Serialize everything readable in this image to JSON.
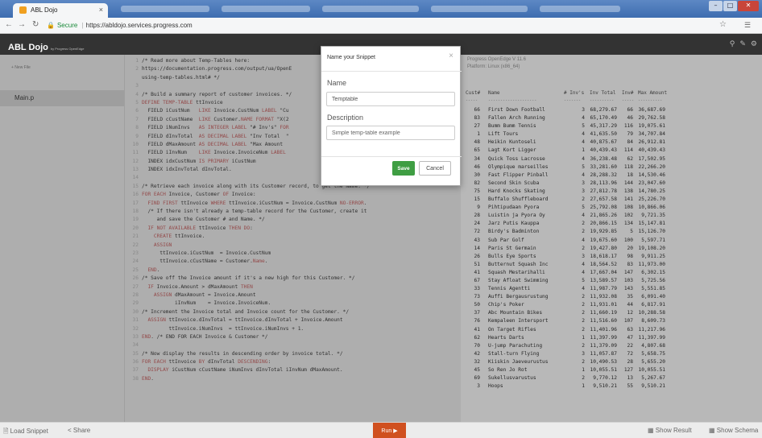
{
  "browser": {
    "tab_title": "ABL Dojo",
    "tab_close": "×",
    "secure_label": "Secure",
    "separator": "|",
    "url": "https://abldojo.services.progress.com"
  },
  "app": {
    "logo_main": "ABL Dojo",
    "logo_by": "by Progress OpenEdge"
  },
  "sidebar": {
    "new_file": "+ New File",
    "files": [
      "Main.p"
    ]
  },
  "editor": {
    "lines": [
      {
        "n": "1",
        "parts": [
          [
            "/* Read more about Temp-Tables here:",
            ""
          ]
        ]
      },
      {
        "n": "2",
        "parts": [
          [
            "https://documentation.progress.com/output/ua/OpenE",
            ""
          ]
        ]
      },
      {
        "n": "",
        "parts": [
          [
            "using-temp-tables.html# */",
            ""
          ]
        ]
      },
      {
        "n": "3",
        "parts": [
          [
            "",
            ""
          ]
        ]
      },
      {
        "n": "4",
        "parts": [
          [
            "/* Build a summary report of customer invoices. */",
            ""
          ]
        ]
      },
      {
        "n": "5",
        "parts": [
          [
            "DEFINE TEMP-TABLE",
            "kw"
          ],
          [
            " ttInvoice",
            ""
          ]
        ]
      },
      {
        "n": "6",
        "parts": [
          [
            "  FIELD iCustNum   ",
            ""
          ],
          [
            "LIKE",
            "kw"
          ],
          [
            " Invoice.CustNum ",
            ""
          ],
          [
            "LABEL",
            "kw"
          ],
          [
            " \"Cu",
            ""
          ]
        ]
      },
      {
        "n": "7",
        "parts": [
          [
            "  FIELD cCustName  ",
            ""
          ],
          [
            "LIKE",
            "kw"
          ],
          [
            " Customer.",
            ""
          ],
          [
            "NAME FORMAT",
            "kw"
          ],
          [
            " \"X(2",
            ""
          ]
        ]
      },
      {
        "n": "8",
        "parts": [
          [
            "  FIELD iNumInvs   ",
            ""
          ],
          [
            "AS INTEGER LABEL",
            "kw"
          ],
          [
            " \"# Inv's\" ",
            ""
          ],
          [
            "FOR",
            "kw"
          ]
        ]
      },
      {
        "n": "9",
        "parts": [
          [
            "  FIELD dInvTotal  ",
            ""
          ],
          [
            "AS DECIMAL LABEL",
            "kw"
          ],
          [
            " \"Inv Total  \"",
            ""
          ]
        ]
      },
      {
        "n": "10",
        "parts": [
          [
            "  FIELD dMaxAmount ",
            ""
          ],
          [
            "AS DECIMAL LABEL",
            "kw"
          ],
          [
            " \"Max Amount",
            ""
          ]
        ]
      },
      {
        "n": "11",
        "parts": [
          [
            "  FIELD iInvNum    ",
            ""
          ],
          [
            "LIKE",
            "kw"
          ],
          [
            " Invoice.InvoiceNum ",
            ""
          ],
          [
            "LABEL",
            "kw"
          ]
        ]
      },
      {
        "n": "12",
        "parts": [
          [
            "  INDEX idxCustNum ",
            ""
          ],
          [
            "IS PRIMARY",
            "kw"
          ],
          [
            " iCustNum",
            ""
          ]
        ]
      },
      {
        "n": "13",
        "parts": [
          [
            "  INDEX idxInvTotal dInvTotal.",
            ""
          ]
        ]
      },
      {
        "n": "14",
        "parts": [
          [
            "",
            ""
          ]
        ]
      },
      {
        "n": "15",
        "parts": [
          [
            "/* Retrieve each invoice along with its Customer record, to get the Name. */",
            ""
          ]
        ]
      },
      {
        "n": "16",
        "parts": [
          [
            "FOR EACH",
            "kw"
          ],
          [
            " Invoice, Customer ",
            ""
          ],
          [
            "OF",
            "kw"
          ],
          [
            " Invoice:",
            ""
          ]
        ]
      },
      {
        "n": "17",
        "parts": [
          [
            "  ",
            ""
          ],
          [
            "FIND FIRST",
            "kw"
          ],
          [
            " ttInvoice ",
            ""
          ],
          [
            "WHERE",
            "kw"
          ],
          [
            " ttInvoice.iCustNum = Invoice.CustNum ",
            ""
          ],
          [
            "NO-ERROR",
            "kw"
          ],
          [
            ".",
            ""
          ]
        ]
      },
      {
        "n": "18",
        "parts": [
          [
            "  /* If there isn't already a temp-table record for the Customer, create it",
            ""
          ]
        ]
      },
      {
        "n": "19",
        "parts": [
          [
            "     and save the Customer # and Name. */",
            ""
          ]
        ]
      },
      {
        "n": "20",
        "parts": [
          [
            "  ",
            ""
          ],
          [
            "IF NOT AVAILABLE",
            "kw"
          ],
          [
            " ttInvoice ",
            ""
          ],
          [
            "THEN DO",
            "kw"
          ],
          [
            ":",
            ""
          ]
        ]
      },
      {
        "n": "21",
        "parts": [
          [
            "    ",
            ""
          ],
          [
            "CREATE",
            "kw"
          ],
          [
            " ttInvoice.",
            ""
          ]
        ]
      },
      {
        "n": "22",
        "parts": [
          [
            "    ",
            ""
          ],
          [
            "ASSIGN",
            "kw"
          ]
        ]
      },
      {
        "n": "23",
        "parts": [
          [
            "      ttInvoice.iCustNum  = Invoice.CustNum",
            ""
          ]
        ]
      },
      {
        "n": "24",
        "parts": [
          [
            "      ttInvoice.cCustName = Customer.",
            ""
          ],
          [
            "Name",
            "kw"
          ],
          [
            ".",
            ""
          ]
        ]
      },
      {
        "n": "25",
        "parts": [
          [
            "  ",
            ""
          ],
          [
            "END",
            "kw"
          ],
          [
            ".",
            ""
          ]
        ]
      },
      {
        "n": "26",
        "parts": [
          [
            "/* Save off the Invoice amount if it's a new high for this Customer. */",
            ""
          ]
        ]
      },
      {
        "n": "27",
        "parts": [
          [
            "  ",
            ""
          ],
          [
            "IF",
            "kw"
          ],
          [
            " Invoice.Amount > dMaxAmount ",
            ""
          ],
          [
            "THEN",
            "kw"
          ]
        ]
      },
      {
        "n": "28",
        "parts": [
          [
            "    ",
            ""
          ],
          [
            "ASSIGN",
            "kw"
          ],
          [
            " dMaxAmount = Invoice.Amount",
            ""
          ]
        ]
      },
      {
        "n": "29",
        "parts": [
          [
            "           iInvNum    = Invoice.InvoiceNum.",
            ""
          ]
        ]
      },
      {
        "n": "30",
        "parts": [
          [
            "/* Increment the Invoice total and Invoice count for the Customer. */",
            ""
          ]
        ]
      },
      {
        "n": "31",
        "parts": [
          [
            "  ",
            ""
          ],
          [
            "ASSIGN",
            "kw"
          ],
          [
            " ttInvoice.dInvTotal = ttInvoice.dInvTotal + Invoice.Amount",
            ""
          ]
        ]
      },
      {
        "n": "32",
        "parts": [
          [
            "         ttInvoice.iNumInvs  = ttInvoice.iNumInvs + 1.",
            ""
          ]
        ]
      },
      {
        "n": "33",
        "parts": [
          [
            "END",
            "kw"
          ],
          [
            ". /* END FOR EACH Invoice & Customer */",
            ""
          ]
        ]
      },
      {
        "n": "34",
        "parts": [
          [
            "",
            ""
          ]
        ]
      },
      {
        "n": "35",
        "parts": [
          [
            "/* Now display the results in descending order by invoice total. */",
            ""
          ]
        ]
      },
      {
        "n": "36",
        "parts": [
          [
            "FOR EACH",
            "kw"
          ],
          [
            " ttInvoice ",
            ""
          ],
          [
            "BY",
            "kw"
          ],
          [
            " dInvTotal ",
            ""
          ],
          [
            "DESCENDING",
            "kw"
          ],
          [
            ":",
            ""
          ]
        ]
      },
      {
        "n": "37",
        "parts": [
          [
            "  ",
            ""
          ],
          [
            "DISPLAY",
            "kw"
          ],
          [
            " iCustNum cCustName iNumInvs dInvTotal iInvNum dMaxAmount.",
            ""
          ]
        ]
      },
      {
        "n": "38",
        "parts": [
          [
            "END",
            "kw"
          ],
          [
            ".",
            ""
          ]
        ]
      }
    ]
  },
  "output": {
    "line1": "Progress OpenEdge V 11.6",
    "line2": "Platform: Linux (x86_64)",
    "headers": {
      "cust": "Cust#",
      "name": "Name",
      "invs": "# Inv's",
      "total": "Inv Total",
      "invnum": "Inv#",
      "max": "Max Amount"
    },
    "dashes": {
      "cust": "-----",
      "name": "--------------------",
      "invs": "-------",
      "total": "----------",
      "invnum": "-----",
      "max": "----------"
    },
    "rows": [
      [
        "66",
        "First Down Football",
        "3",
        "68,279.67",
        "66",
        "36,687.69"
      ],
      [
        "83",
        "Fallen Arch Running",
        "4",
        "65,170.49",
        "46",
        "29,762.58"
      ],
      [
        "27",
        "Bumm Bumm Tennis",
        "5",
        "45,317.29",
        "116",
        "19,075.61"
      ],
      [
        "1",
        "Lift Tours",
        "4",
        "41,635.50",
        "79",
        "34,707.84"
      ],
      [
        "48",
        "Heikin Kuntoseli",
        "4",
        "40,875.67",
        "84",
        "26,912.81"
      ],
      [
        "65",
        "Lagt Kort Ligger",
        "1",
        "40,439.43",
        "114",
        "40,439.43"
      ],
      [
        "34",
        "Quick Toss Lacrosse",
        "4",
        "36,238.48",
        "62",
        "17,502.95"
      ],
      [
        "46",
        "Olympique marseilles",
        "5",
        "33,281.60",
        "118",
        "22,266.20"
      ],
      [
        "30",
        "Fast Flipper Pinball",
        "4",
        "28,288.32",
        "18",
        "14,530.46"
      ],
      [
        "82",
        "Second Skin Scuba",
        "3",
        "28,113.96",
        "144",
        "23,047.60"
      ],
      [
        "75",
        "Hard Knocks Skating",
        "3",
        "27,812.78",
        "138",
        "14,780.25"
      ],
      [
        "15",
        "Buffalo Shuffleboard",
        "2",
        "27,657.58",
        "141",
        "25,226.70"
      ],
      [
        "9",
        "Pihtipudaan Pyora",
        "5",
        "25,792.08",
        "108",
        "10,866.06"
      ],
      [
        "28",
        "Luistin ja Pyora Oy",
        "4",
        "21,865.26",
        "102",
        "9,721.35"
      ],
      [
        "24",
        "Jarz Putis Kauppa",
        "2",
        "20,866.15",
        "134",
        "15,147.81"
      ],
      [
        "72",
        "Birdy's Badminton",
        "2",
        "19,929.85",
        "5",
        "15,126.70"
      ],
      [
        "43",
        "Sub Par Golf",
        "4",
        "19,675.60",
        "100",
        "5,597.71"
      ],
      [
        "14",
        "Paris St Germain",
        "2",
        "19,427.80",
        "20",
        "19,108.20"
      ],
      [
        "26",
        "Bulls Eye Sports",
        "3",
        "18,618.17",
        "98",
        "9,911.25"
      ],
      [
        "51",
        "Butternut Squash Inc",
        "4",
        "18,564.52",
        "83",
        "11,973.00"
      ],
      [
        "41",
        "Squash Mestarihalli",
        "4",
        "17,667.04",
        "147",
        "6,302.15"
      ],
      [
        "67",
        "Stay Afloat Swimming",
        "5",
        "13,589.57",
        "103",
        "5,725.56"
      ],
      [
        "33",
        "Tennis Agentti",
        "4",
        "11,987.79",
        "143",
        "5,551.85"
      ],
      [
        "73",
        "Auffi Bergausrustung",
        "2",
        "11,932.08",
        "35",
        "6,091.40"
      ],
      [
        "50",
        "Chip's Poker",
        "2",
        "11,931.01",
        "44",
        "6,817.91"
      ],
      [
        "37",
        "Abc Mountain Bikes",
        "2",
        "11,660.19",
        "12",
        "10,288.58"
      ],
      [
        "76",
        "Kempaleen Intersport",
        "2",
        "11,516.60",
        "107",
        "8,609.73"
      ],
      [
        "41",
        "On Target Rifles",
        "2",
        "11,401.96",
        "63",
        "11,217.96"
      ],
      [
        "62",
        "Hearts Darts",
        "1",
        "11,397.99",
        "47",
        "11,397.99"
      ],
      [
        "70",
        "U-jump Parachuting",
        "2",
        "11,379.09",
        "22",
        "4,807.68"
      ],
      [
        "42",
        "Stall-turn Flying",
        "3",
        "11,057.87",
        "72",
        "5,658.75"
      ],
      [
        "32",
        "Kiiskin Jaeveurustus",
        "2",
        "10,490.53",
        "28",
        "5,655.20"
      ],
      [
        "45",
        "So Ren Jo Rot",
        "1",
        "10,055.51",
        "127",
        "10,055.51"
      ],
      [
        "69",
        "Sukellusvarustus",
        "2",
        "9,770.12",
        "13",
        "5,267.67"
      ],
      [
        "3",
        "Hoops",
        "1",
        "9,510.21",
        "55",
        "9,510.21"
      ]
    ]
  },
  "modal": {
    "title": "Name your Snippet",
    "close": "×",
    "name_label": "Name",
    "name_value": "Temptable",
    "desc_label": "Description",
    "desc_placeholder": "Simple temp-table example",
    "save": "Save",
    "cancel": "Cancel"
  },
  "footer": {
    "load": "Load Snippet",
    "share": "Share",
    "run": "Run ▶",
    "show_result": "Show Result",
    "show_schema": "Show Schema"
  }
}
